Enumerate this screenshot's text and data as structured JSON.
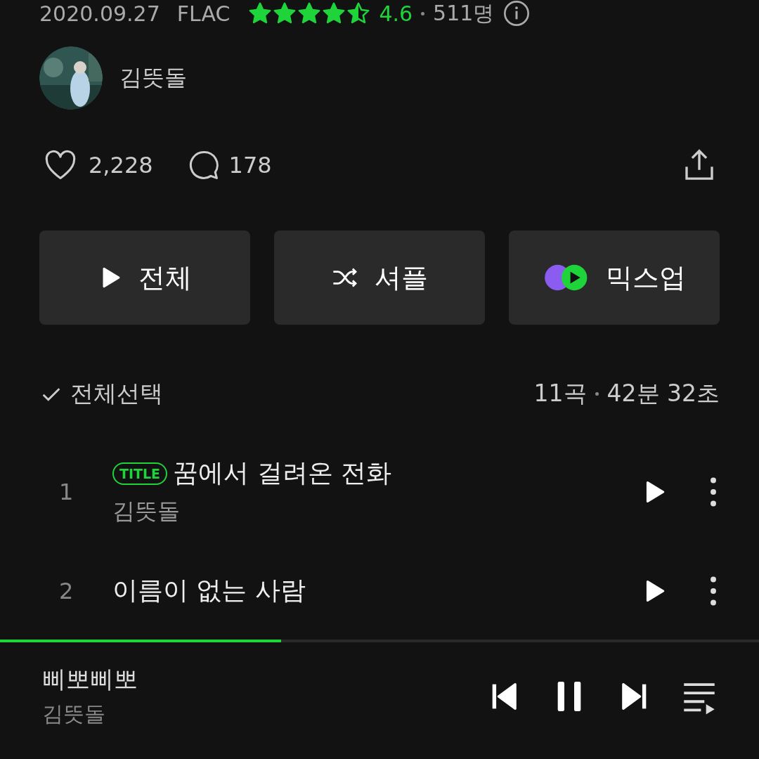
{
  "album_meta": {
    "date": "2020.09.27",
    "format": "FLAC",
    "stars": 4.5,
    "rating": "4.6",
    "raters": "511명"
  },
  "artist": {
    "name": "김뜻돌"
  },
  "stats": {
    "likes": "2,228",
    "comments": "178"
  },
  "actions": [
    {
      "kind": "play",
      "label": "전체"
    },
    {
      "kind": "shuffle",
      "label": "셔플"
    },
    {
      "kind": "mixup",
      "label": "믹스업"
    }
  ],
  "list_header": {
    "select_all": "전체선택",
    "count": "11곡",
    "duration": "42분 32초"
  },
  "tracks": [
    {
      "number": "1",
      "badge": "TITLE",
      "title": "꿈에서 걸려온 전화",
      "artist": "김뜻돌"
    },
    {
      "number": "2",
      "title": "이름이 없는 사람"
    }
  ],
  "player": {
    "title": "삐뽀삐뽀",
    "artist": "김뜻돌",
    "level": 0.37,
    "playing": true
  }
}
